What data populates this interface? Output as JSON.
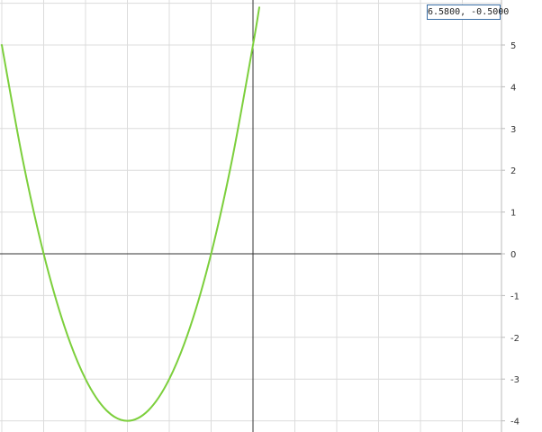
{
  "readout": {
    "text": "6.5800, -0.5000"
  },
  "colors": {
    "curve": "#7ccf3c",
    "grid": "#dcdcdc",
    "axis": "#333333",
    "frame": "#bbbbbb"
  },
  "chart_data": {
    "type": "line",
    "title": "",
    "xlabel": "",
    "ylabel": "",
    "xlim": [
      -6,
      6
    ],
    "ylim": [
      -4,
      6
    ],
    "grid": true,
    "y_axis_label_side": "right",
    "yticks": [
      "5",
      "4",
      "3",
      "2",
      "1",
      "0",
      "-1",
      "-2",
      "-3",
      "-4"
    ],
    "series": [
      {
        "x": [
          -6,
          -5.5,
          -5,
          -4.5,
          -4,
          -3.5,
          -3,
          -2.5,
          -2,
          -1.5,
          -1,
          -0.5,
          0,
          0.15
        ],
        "y": [
          5,
          2.25,
          0,
          -1.75,
          -3,
          -3.75,
          -4,
          -3.75,
          -3,
          -1.75,
          0,
          2.25,
          5,
          5.9
        ]
      }
    ]
  }
}
